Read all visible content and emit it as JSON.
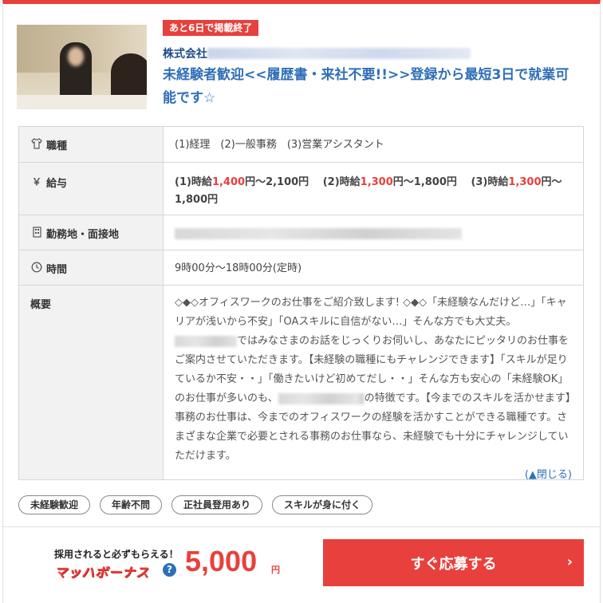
{
  "badge": "あと6日で掲載終了",
  "company": "株式会社",
  "title": "未経験者歓迎<<履歴書・来社不要!!>>登録から最短3日で就業可能です☆",
  "table": {
    "job_type": {
      "label": "職種",
      "icon": "shirt-icon",
      "value": "(1)経理　(2)一般事務　(3)営業アシスタント"
    },
    "salary": {
      "label": "給与",
      "icon": "yen-icon",
      "p1_prefix": "(1)時給",
      "p1_low": "1,400",
      "p1_rest": "円～2,100円　",
      "p2_prefix": "(2)時給",
      "p2_low": "1,300",
      "p2_rest": "円～1,800円　",
      "p3_prefix": "(3)時給",
      "p3_low": "1,300",
      "p3_rest": "円～1,800円"
    },
    "location": {
      "label": "勤務地・面接地",
      "icon": "building-icon"
    },
    "hours": {
      "label": "時間",
      "icon": "clock-icon",
      "value": "9時00分～18時00分(定時)"
    },
    "overview": {
      "label": "概要",
      "text_a": "◇◆◇オフィスワークのお仕事をご紹介致します! ◇◆◇「未経験なんだけど…」「キャリアが浅いから不安」「OAスキルに自信がない…」そんな方でも大丈夫。",
      "text_b": "ではみなさまのお話をじっくりお伺いし、あなたにピッタリのお仕事をご案内させていただきます。【未経験の職種にもチャレンジできます】「スキルが足りているか不安・・」「働きたいけど初めてだし・・」そんな方も安心の「未経験OK」のお仕事が多いのも、",
      "text_c": "の特徴です。【今までのスキルを活かせます】事務のお仕事は、今までのオフィスワークの経験を活かすことができる職種です。さまざまな企業で必要とされる事務のお仕事なら、未経験でも十分にチャレンジしていただけます。",
      "close_link": "(▲閉じる)"
    }
  },
  "tags": [
    "未経験歓迎",
    "年齢不問",
    "正社員登用あり",
    "スキルが身に付く"
  ],
  "bonus": {
    "caption": "採用されると必ずもらえる！",
    "logo": "マッハボーナス",
    "help": "?",
    "amount": "5,000",
    "unit": "円"
  },
  "apply_button": "すぐ応募する",
  "apply_chevron": "›",
  "colors": {
    "accent": "#e8403c",
    "link": "#2f6fb8",
    "company": "#1e4c8c"
  }
}
